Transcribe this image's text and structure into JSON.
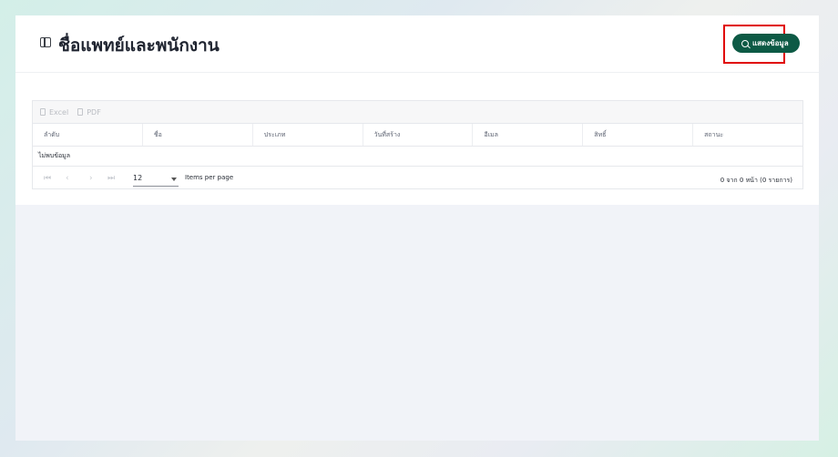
{
  "header": {
    "title": "ชื่อแพทย์และพนักงาน",
    "show_button_label": "แสดงข้อมูล"
  },
  "toolbar": {
    "excel_label": "Excel",
    "pdf_label": "PDF"
  },
  "table": {
    "columns": [
      "ลำดับ",
      "ชื่อ",
      "ประเภท",
      "วันที่สร้าง",
      "อีเมล",
      "สิทธิ์",
      "สถานะ"
    ],
    "empty_text": "ไม่พบข้อมูล"
  },
  "pagination": {
    "first_icon": "⏮",
    "prev_icon": "‹",
    "next_icon": "›",
    "last_icon": "⏭",
    "per_page_value": "12",
    "per_page_label": "Items per page",
    "summary": "0 จาก 0 หน้า (0 รายการ)"
  },
  "colors": {
    "primary": "#0d5a45",
    "highlight": "#e00000"
  }
}
